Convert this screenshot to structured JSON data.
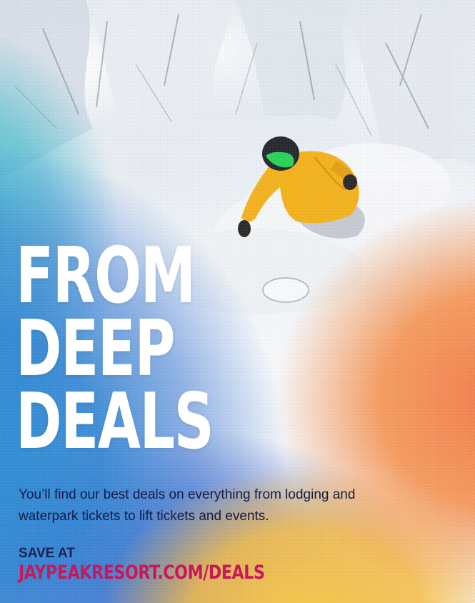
{
  "ad": {
    "headline_lines": [
      "FROM",
      "DEEP",
      "DEALS"
    ],
    "body": "You’ll find our best deals on everything from lodging and waterpark tickets to lift tickets and events.",
    "cta_label": "SAVE AT",
    "cta_url": "JAYPEAKRESORT.COM/DEALS"
  },
  "colors": {
    "headline": "#ffffff",
    "body_text": "#141b45",
    "cta_label": "#1b2150",
    "cta_url": "#c8185a",
    "jacket": "#f2b21e",
    "gradient_blue": "#2d82d2",
    "gradient_teal": "#28b4c8",
    "gradient_orange": "#f0784a",
    "gradient_yellow": "#f8be46"
  },
  "image": {
    "subject": "snowboarder-in-powder",
    "icons": [
      "snowboarder-figure",
      "snowboard-icon"
    ]
  }
}
